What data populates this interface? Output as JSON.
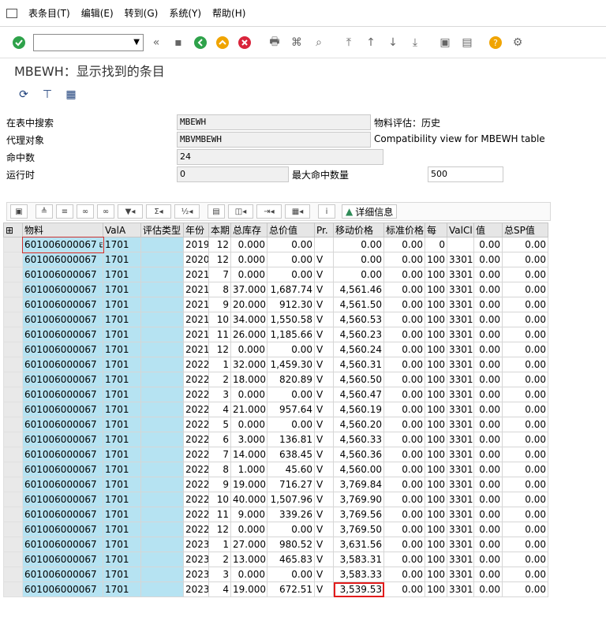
{
  "menu": {
    "items": [
      "表条目(T)",
      "编辑(E)",
      "转到(G)",
      "系统(Y)",
      "帮助(H)"
    ]
  },
  "toolbar": {
    "command_value": "",
    "icons": [
      "check-icon",
      "back-icon",
      "save-icon",
      "exit-icon",
      "up-icon",
      "cancel-icon",
      "print-icon",
      "find-icon",
      "find-next-icon",
      "page-first-icon",
      "page-prev-icon",
      "page-next-icon",
      "page-last-icon",
      "new-session-icon",
      "shortcut-icon",
      "help-icon",
      "settings-icon"
    ]
  },
  "title": "MBEWH：显示找到的条目",
  "form": {
    "search_label": "在表中搜索",
    "search_value": "MBEWH",
    "material_valuation": "物料评估：历史",
    "proxy_label": "代理对象",
    "proxy_value": "MBVMBEWH",
    "proxy_desc": "Compatibility view for MBEWH table",
    "hits_label": "命中数",
    "hits_value": "24",
    "runtime_label": "运行时",
    "runtime_value": "0",
    "max_hits_label": "最大命中数量",
    "max_hits_value": "500"
  },
  "alv": {
    "detail_label": "详细信息"
  },
  "table": {
    "headers": [
      "",
      "物料",
      "ValA",
      "评估类型",
      "年份",
      "本期",
      "总库存",
      "总价值",
      "Pr.",
      "移动价格",
      "标准价格",
      "每",
      "ValCl",
      "值",
      "总SP值"
    ],
    "rows": [
      [
        "601006000067",
        "1701",
        "",
        "2019",
        "12",
        "0.000",
        "0.00",
        "",
        "0.00",
        "0.00",
        "0",
        "",
        "0.00",
        "0.00"
      ],
      [
        "601006000067",
        "1701",
        "",
        "2020",
        "12",
        "0.000",
        "0.00",
        "V",
        "0.00",
        "0.00",
        "100",
        "3301",
        "0.00",
        "0.00"
      ],
      [
        "601006000067",
        "1701",
        "",
        "2021",
        "7",
        "0.000",
        "0.00",
        "V",
        "0.00",
        "0.00",
        "100",
        "3301",
        "0.00",
        "0.00"
      ],
      [
        "601006000067",
        "1701",
        "",
        "2021",
        "8",
        "37.000",
        "1,687.74",
        "V",
        "4,561.46",
        "0.00",
        "100",
        "3301",
        "0.00",
        "0.00"
      ],
      [
        "601006000067",
        "1701",
        "",
        "2021",
        "9",
        "20.000",
        "912.30",
        "V",
        "4,561.50",
        "0.00",
        "100",
        "3301",
        "0.00",
        "0.00"
      ],
      [
        "601006000067",
        "1701",
        "",
        "2021",
        "10",
        "34.000",
        "1,550.58",
        "V",
        "4,560.53",
        "0.00",
        "100",
        "3301",
        "0.00",
        "0.00"
      ],
      [
        "601006000067",
        "1701",
        "",
        "2021",
        "11",
        "26.000",
        "1,185.66",
        "V",
        "4,560.23",
        "0.00",
        "100",
        "3301",
        "0.00",
        "0.00"
      ],
      [
        "601006000067",
        "1701",
        "",
        "2021",
        "12",
        "0.000",
        "0.00",
        "V",
        "4,560.24",
        "0.00",
        "100",
        "3301",
        "0.00",
        "0.00"
      ],
      [
        "601006000067",
        "1701",
        "",
        "2022",
        "1",
        "32.000",
        "1,459.30",
        "V",
        "4,560.31",
        "0.00",
        "100",
        "3301",
        "0.00",
        "0.00"
      ],
      [
        "601006000067",
        "1701",
        "",
        "2022",
        "2",
        "18.000",
        "820.89",
        "V",
        "4,560.50",
        "0.00",
        "100",
        "3301",
        "0.00",
        "0.00"
      ],
      [
        "601006000067",
        "1701",
        "",
        "2022",
        "3",
        "0.000",
        "0.00",
        "V",
        "4,560.47",
        "0.00",
        "100",
        "3301",
        "0.00",
        "0.00"
      ],
      [
        "601006000067",
        "1701",
        "",
        "2022",
        "4",
        "21.000",
        "957.64",
        "V",
        "4,560.19",
        "0.00",
        "100",
        "3301",
        "0.00",
        "0.00"
      ],
      [
        "601006000067",
        "1701",
        "",
        "2022",
        "5",
        "0.000",
        "0.00",
        "V",
        "4,560.20",
        "0.00",
        "100",
        "3301",
        "0.00",
        "0.00"
      ],
      [
        "601006000067",
        "1701",
        "",
        "2022",
        "6",
        "3.000",
        "136.81",
        "V",
        "4,560.33",
        "0.00",
        "100",
        "3301",
        "0.00",
        "0.00"
      ],
      [
        "601006000067",
        "1701",
        "",
        "2022",
        "7",
        "14.000",
        "638.45",
        "V",
        "4,560.36",
        "0.00",
        "100",
        "3301",
        "0.00",
        "0.00"
      ],
      [
        "601006000067",
        "1701",
        "",
        "2022",
        "8",
        "1.000",
        "45.60",
        "V",
        "4,560.00",
        "0.00",
        "100",
        "3301",
        "0.00",
        "0.00"
      ],
      [
        "601006000067",
        "1701",
        "",
        "2022",
        "9",
        "19.000",
        "716.27",
        "V",
        "3,769.84",
        "0.00",
        "100",
        "3301",
        "0.00",
        "0.00"
      ],
      [
        "601006000067",
        "1701",
        "",
        "2022",
        "10",
        "40.000",
        "1,507.96",
        "V",
        "3,769.90",
        "0.00",
        "100",
        "3301",
        "0.00",
        "0.00"
      ],
      [
        "601006000067",
        "1701",
        "",
        "2022",
        "11",
        "9.000",
        "339.26",
        "V",
        "3,769.56",
        "0.00",
        "100",
        "3301",
        "0.00",
        "0.00"
      ],
      [
        "601006000067",
        "1701",
        "",
        "2022",
        "12",
        "0.000",
        "0.00",
        "V",
        "3,769.50",
        "0.00",
        "100",
        "3301",
        "0.00",
        "0.00"
      ],
      [
        "601006000067",
        "1701",
        "",
        "2023",
        "1",
        "27.000",
        "980.52",
        "V",
        "3,631.56",
        "0.00",
        "100",
        "3301",
        "0.00",
        "0.00"
      ],
      [
        "601006000067",
        "1701",
        "",
        "2023",
        "2",
        "13.000",
        "465.83",
        "V",
        "3,583.31",
        "0.00",
        "100",
        "3301",
        "0.00",
        "0.00"
      ],
      [
        "601006000067",
        "1701",
        "",
        "2023",
        "3",
        "0.000",
        "0.00",
        "V",
        "3,583.33",
        "0.00",
        "100",
        "3301",
        "0.00",
        "0.00"
      ],
      [
        "601006000067",
        "1701",
        "",
        "2023",
        "4",
        "19.000",
        "672.51",
        "V",
        "3,539.53",
        "0.00",
        "100",
        "3301",
        "0.00",
        "0.00"
      ]
    ]
  }
}
